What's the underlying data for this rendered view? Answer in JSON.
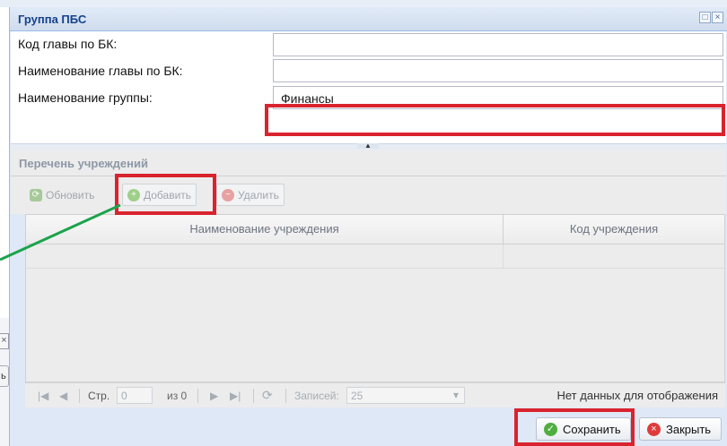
{
  "colors": {
    "highlight": "#d9232e",
    "arrow": "#1aa34a",
    "title_text": "#15428b"
  },
  "background_window": {
    "close_glyph": "×",
    "button_fragment": "ь"
  },
  "dialog": {
    "title": "Группа ПБС",
    "tools": {
      "maximize_glyph": "□",
      "close_glyph": "×"
    },
    "form": {
      "chapter_code_label": "Код главы по БК:",
      "chapter_code_value": "",
      "chapter_name_label": "Наименование главы по БК:",
      "chapter_name_value": "",
      "group_name_label": "Наименование группы:",
      "group_name_value": "Финансы"
    },
    "splitter_glyph": "▲",
    "institutions": {
      "title": "Перечень учреждений",
      "toolbar": {
        "refresh_label": "Обновить",
        "add_label": "Добавить",
        "delete_label": "Удалить"
      },
      "columns": [
        "Наименование учреждения",
        "Код учреждения"
      ],
      "pager": {
        "first_glyph": "|◀",
        "prev_glyph": "◀",
        "page_label": "Стр.",
        "page_value": "0",
        "of_label": "из 0",
        "next_glyph": "▶",
        "last_glyph": "▶|",
        "refresh_glyph": "⟳",
        "records_label": "Записей:",
        "records_value": "25",
        "dropdown_glyph": "▾",
        "empty_message": "Нет данных для отображения"
      }
    },
    "buttons": {
      "save_label": "Сохранить",
      "close_label": "Закрыть"
    },
    "icons": {
      "refresh": "refresh-icon",
      "add": "plus-icon",
      "delete": "minus-icon",
      "save": "check-icon",
      "close": "cancel-icon"
    }
  }
}
